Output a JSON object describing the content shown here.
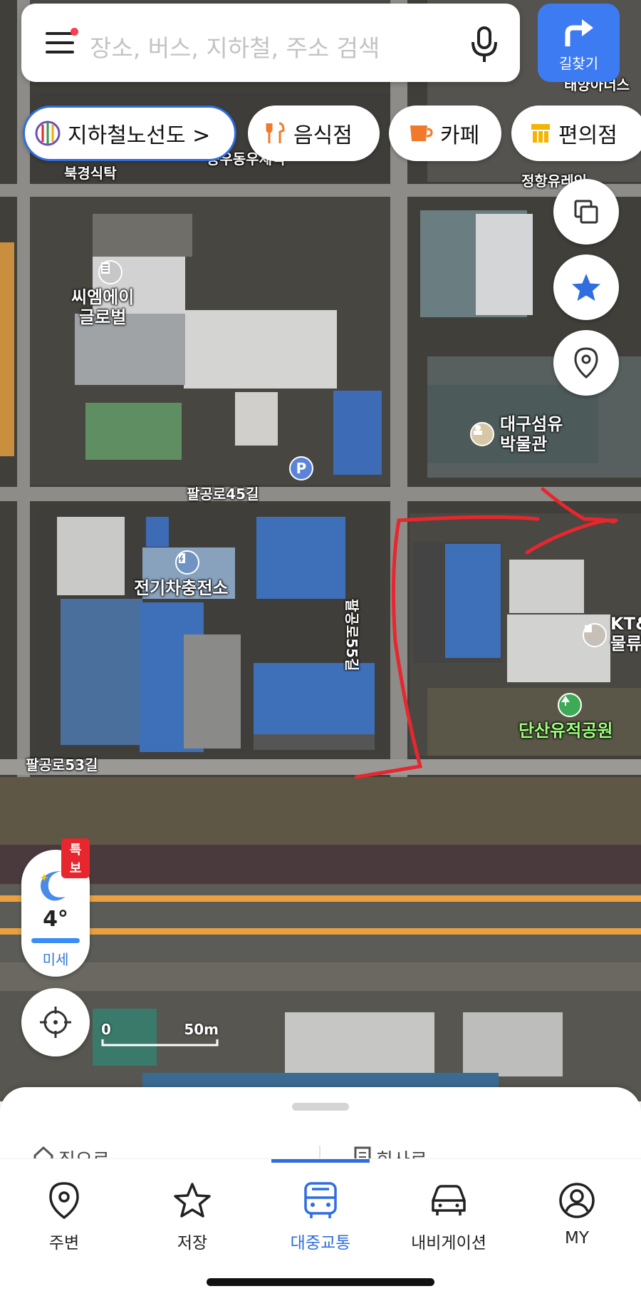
{
  "search": {
    "placeholder": "장소, 버스, 지하철, 주소 검색",
    "route_label": "길찾기"
  },
  "chips": [
    {
      "label": "지하철노선도 >",
      "icon": "subway-line-icon"
    },
    {
      "label": "음식점",
      "icon": "fork-knife-icon"
    },
    {
      "label": "카페",
      "icon": "coffee-cup-icon"
    },
    {
      "label": "편의점",
      "icon": "store-icon"
    }
  ],
  "map": {
    "labels": {
      "place_a": "북경식탁",
      "place_b": "동우동우세적",
      "place_c": "태양아너스",
      "place_d": "정항유레인",
      "cm": "씨엠에이\n글로벌",
      "museum": "대구섬유\n박물관",
      "road_45": "팔공로45길",
      "road_53": "팔공로53길",
      "road_vertical": "팔공로55길",
      "ev": "전기차충전소",
      "kt": "KT&\n물류",
      "park": "단산유적공원"
    },
    "scale": {
      "zero": "0",
      "distance": "50m"
    },
    "accent_route_color": "#e8262e",
    "highway_color": "#e8a040"
  },
  "weather": {
    "badge": "특보",
    "temp": "4°",
    "dust": "미세"
  },
  "sheet": {
    "home": "집으로",
    "work": "회사로"
  },
  "tabs": [
    {
      "label": "주변",
      "icon": "location-pin-icon",
      "active": false
    },
    {
      "label": "저장",
      "icon": "star-icon",
      "active": false
    },
    {
      "label": "대중교통",
      "icon": "bus-icon",
      "active": true
    },
    {
      "label": "내비게이션",
      "icon": "car-icon",
      "active": false
    },
    {
      "label": "MY",
      "icon": "user-icon",
      "active": false
    }
  ]
}
